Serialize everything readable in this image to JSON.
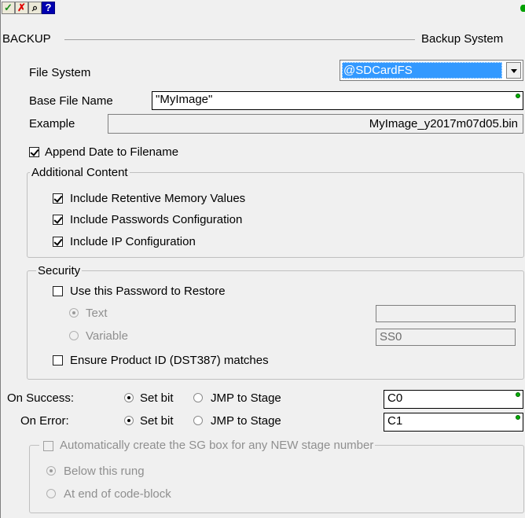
{
  "toolbar": {
    "ok_glyph": "✓",
    "cancel_glyph": "✗",
    "find_glyph": "⌕",
    "help_glyph": "?"
  },
  "header": {
    "left": "BACKUP",
    "right": "Backup System"
  },
  "file_system": {
    "label": "File System",
    "selected": "@SDCardFS"
  },
  "base_file_name": {
    "label": "Base File Name",
    "value": "\"MyImage\""
  },
  "example": {
    "label": "Example",
    "value": "MyImage_y2017m07d05.bin"
  },
  "append_date": {
    "label": "Append Date to Filename",
    "checked": true
  },
  "additional_content": {
    "title": "Additional Content",
    "items": [
      {
        "label": "Include Retentive Memory Values",
        "checked": true
      },
      {
        "label": "Include Passwords Configuration",
        "checked": true
      },
      {
        "label": "Include IP Configuration",
        "checked": true
      }
    ]
  },
  "security": {
    "title": "Security",
    "use_password_label": "Use this Password to Restore",
    "text_radio_label": "Text",
    "variable_radio_label": "Variable",
    "text_value": "",
    "variable_value": "SS0",
    "ensure_product_label": "Ensure Product ID (DST387) matches"
  },
  "on_success": {
    "label": "On Success:",
    "set_bit_label": "Set bit",
    "jmp_label": "JMP to Stage",
    "value": "C0"
  },
  "on_error": {
    "label": "On Error:",
    "set_bit_label": "Set bit",
    "jmp_label": "JMP to Stage",
    "value": "C1"
  },
  "sg_box": {
    "title": "Automatically create the SG box for any NEW stage number",
    "below_label": "Below this rung",
    "end_label": "At end of code-block"
  }
}
